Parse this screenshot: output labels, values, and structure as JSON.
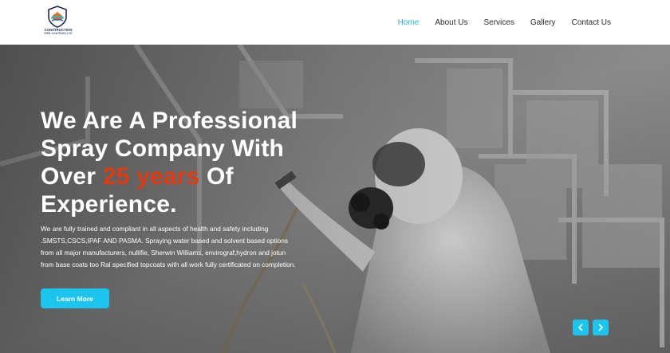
{
  "brand": {
    "logo_line1": "CONSTRUCTION",
    "logo_line2": "FIRE COATINGS LTD"
  },
  "nav": {
    "items": [
      {
        "label": "Home",
        "active": true
      },
      {
        "label": "About Us",
        "active": false
      },
      {
        "label": "Services",
        "active": false
      },
      {
        "label": "Gallery",
        "active": false
      },
      {
        "label": "Contact Us",
        "active": false
      }
    ]
  },
  "hero": {
    "title_part1": "We Are A Professional Spray Company With Over ",
    "title_accent": "25 years",
    "title_part2": " Of Experience.",
    "description": "We are fully trained and compliant in all aspects of health and safety including .SMSTS,CSCS,IPAF AND PASMA. Spraying water based and solvent based options from all major manufacturers, nullifie, Sherwin Williams, envirograf,hydron and jotun from base coats too Ral specified topcoats with all work fully certificated on completion.",
    "cta_label": "Learn More",
    "prev_icon": "chevron-left-icon",
    "next_icon": "chevron-right-icon"
  },
  "colors": {
    "nav_active": "#2ab3d8",
    "accent": "#e03a12",
    "button": "#1bc5ee"
  }
}
